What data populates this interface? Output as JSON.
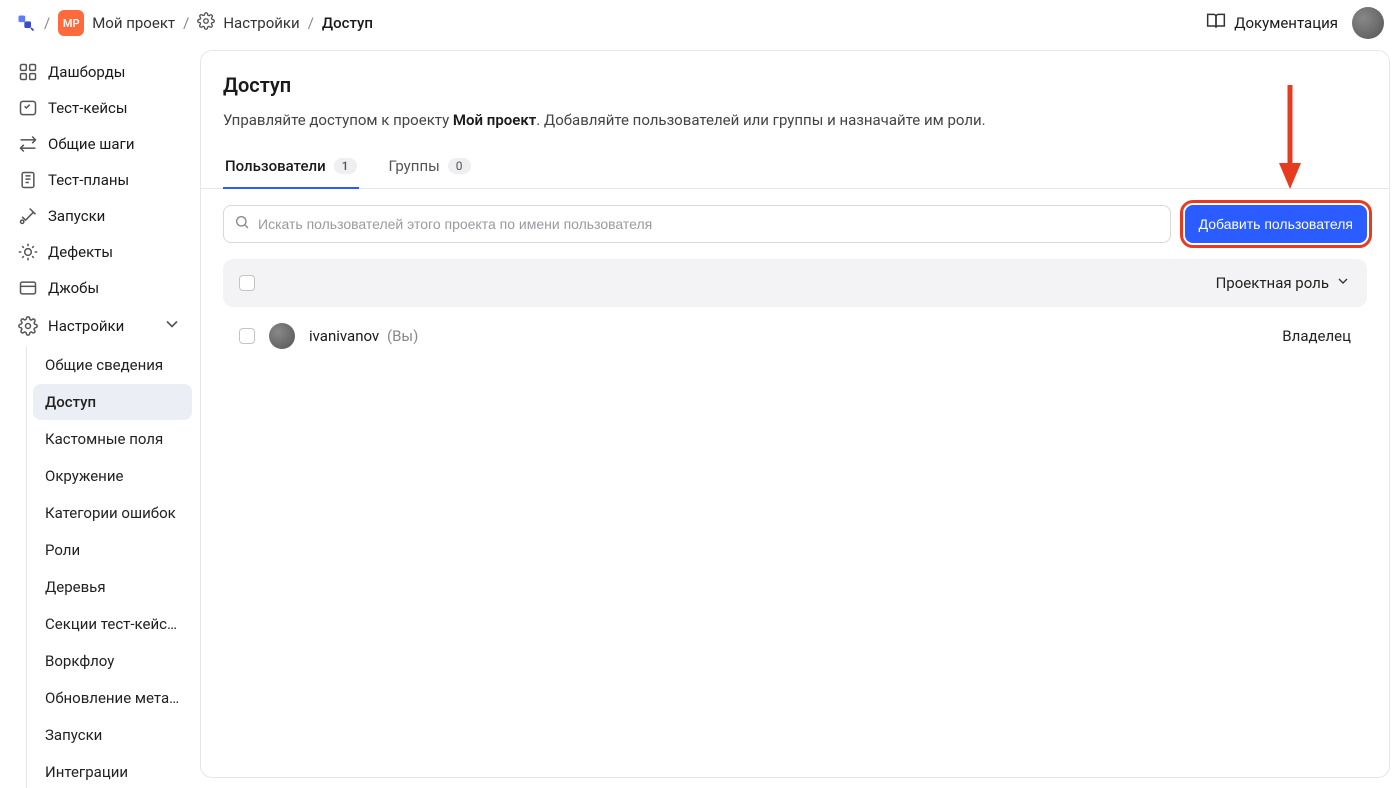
{
  "breadcrumb": {
    "project_badge": "МР",
    "project_name": "Мой проект",
    "settings": "Настройки",
    "current": "Доступ"
  },
  "topbar": {
    "docs": "Документация"
  },
  "sidebar": {
    "items": [
      {
        "id": "dashboards",
        "label": "Дашборды"
      },
      {
        "id": "testcases",
        "label": "Тест-кейсы"
      },
      {
        "id": "shared-steps",
        "label": "Общие шаги"
      },
      {
        "id": "test-plans",
        "label": "Тест-планы"
      },
      {
        "id": "runs",
        "label": "Запуски"
      },
      {
        "id": "defects",
        "label": "Дефекты"
      },
      {
        "id": "jobs",
        "label": "Джобы"
      },
      {
        "id": "settings",
        "label": "Настройки"
      }
    ],
    "settings_children": [
      {
        "id": "general",
        "label": "Общие сведения"
      },
      {
        "id": "access",
        "label": "Доступ",
        "active": true
      },
      {
        "id": "custom-fields",
        "label": "Кастомные поля"
      },
      {
        "id": "environment",
        "label": "Окружение"
      },
      {
        "id": "error-categories",
        "label": "Категории ошибок"
      },
      {
        "id": "roles",
        "label": "Роли"
      },
      {
        "id": "trees",
        "label": "Деревья"
      },
      {
        "id": "tc-sections",
        "label": "Секции тест-кейсов"
      },
      {
        "id": "workflow",
        "label": "Воркфлоу"
      },
      {
        "id": "meta-update",
        "label": "Обновление мета-…"
      },
      {
        "id": "runs2",
        "label": "Запуски"
      },
      {
        "id": "integrations",
        "label": "Интеграции"
      }
    ]
  },
  "page": {
    "title": "Доступ",
    "desc_prefix": "Управляйте доступом к проекту ",
    "desc_project": "Мой проект",
    "desc_suffix": ". Добавляйте пользователей или группы и назначайте им роли."
  },
  "tabs": {
    "users": {
      "label": "Пользователи",
      "count": "1"
    },
    "groups": {
      "label": "Группы",
      "count": "0"
    }
  },
  "toolbar": {
    "search_placeholder": "Искать пользователей этого проекта по имени пользователя",
    "add_user": "Добавить пользователя"
  },
  "table": {
    "role_header": "Проектная роль",
    "rows": [
      {
        "username": "ivanivanov",
        "you": "(Вы)",
        "role": "Владелец"
      }
    ]
  }
}
